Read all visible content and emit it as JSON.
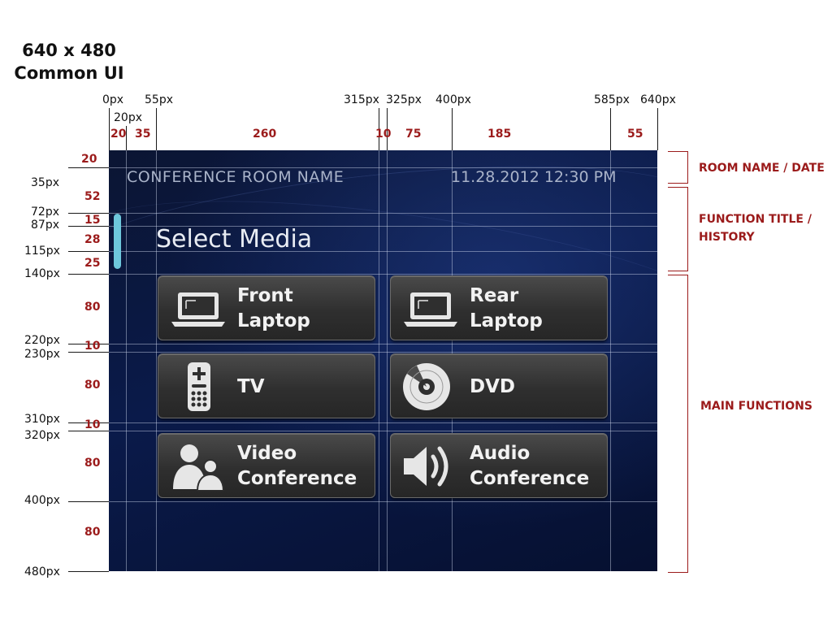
{
  "doc_title": [
    "640 x 480",
    "Common UI"
  ],
  "x_ticks": [
    "0px",
    "20px",
    "55px",
    "315px",
    "325px",
    "400px",
    "585px",
    "640px"
  ],
  "x_dims": [
    "20",
    "35",
    "260",
    "10",
    "75",
    "185",
    "55"
  ],
  "y_ticks": [
    "35px",
    "72px",
    "87px",
    "115px",
    "140px",
    "220px",
    "230px",
    "310px",
    "320px",
    "400px",
    "480px"
  ],
  "y_dims": [
    "20",
    "52",
    "15",
    "28",
    "25",
    "80",
    "10",
    "80",
    "10",
    "80",
    "80"
  ],
  "sections": {
    "room": "ROOM NAME / DATE",
    "function_title": [
      "FUNCTION TITLE /",
      "HISTORY"
    ],
    "main": "MAIN FUNCTIONS"
  },
  "screen": {
    "room_name": "CONFERENCE ROOM NAME",
    "datetime": "11.28.2012  12:30 PM",
    "function_title": "Select Media",
    "buttons": [
      {
        "label": "Front\nLaptop",
        "icon": "laptop-icon"
      },
      {
        "label": "Rear\nLaptop",
        "icon": "laptop-icon"
      },
      {
        "label": "TV",
        "icon": "remote-icon"
      },
      {
        "label": "DVD",
        "icon": "disc-icon"
      },
      {
        "label": "Video\nConference",
        "icon": "people-icon"
      },
      {
        "label": "Audio\nConference",
        "icon": "speaker-icon"
      }
    ]
  },
  "colors": {
    "accent_red": "#9b1b1b",
    "history_bar": "#6ec8dc",
    "screen_bg": "#0a1a4a"
  }
}
